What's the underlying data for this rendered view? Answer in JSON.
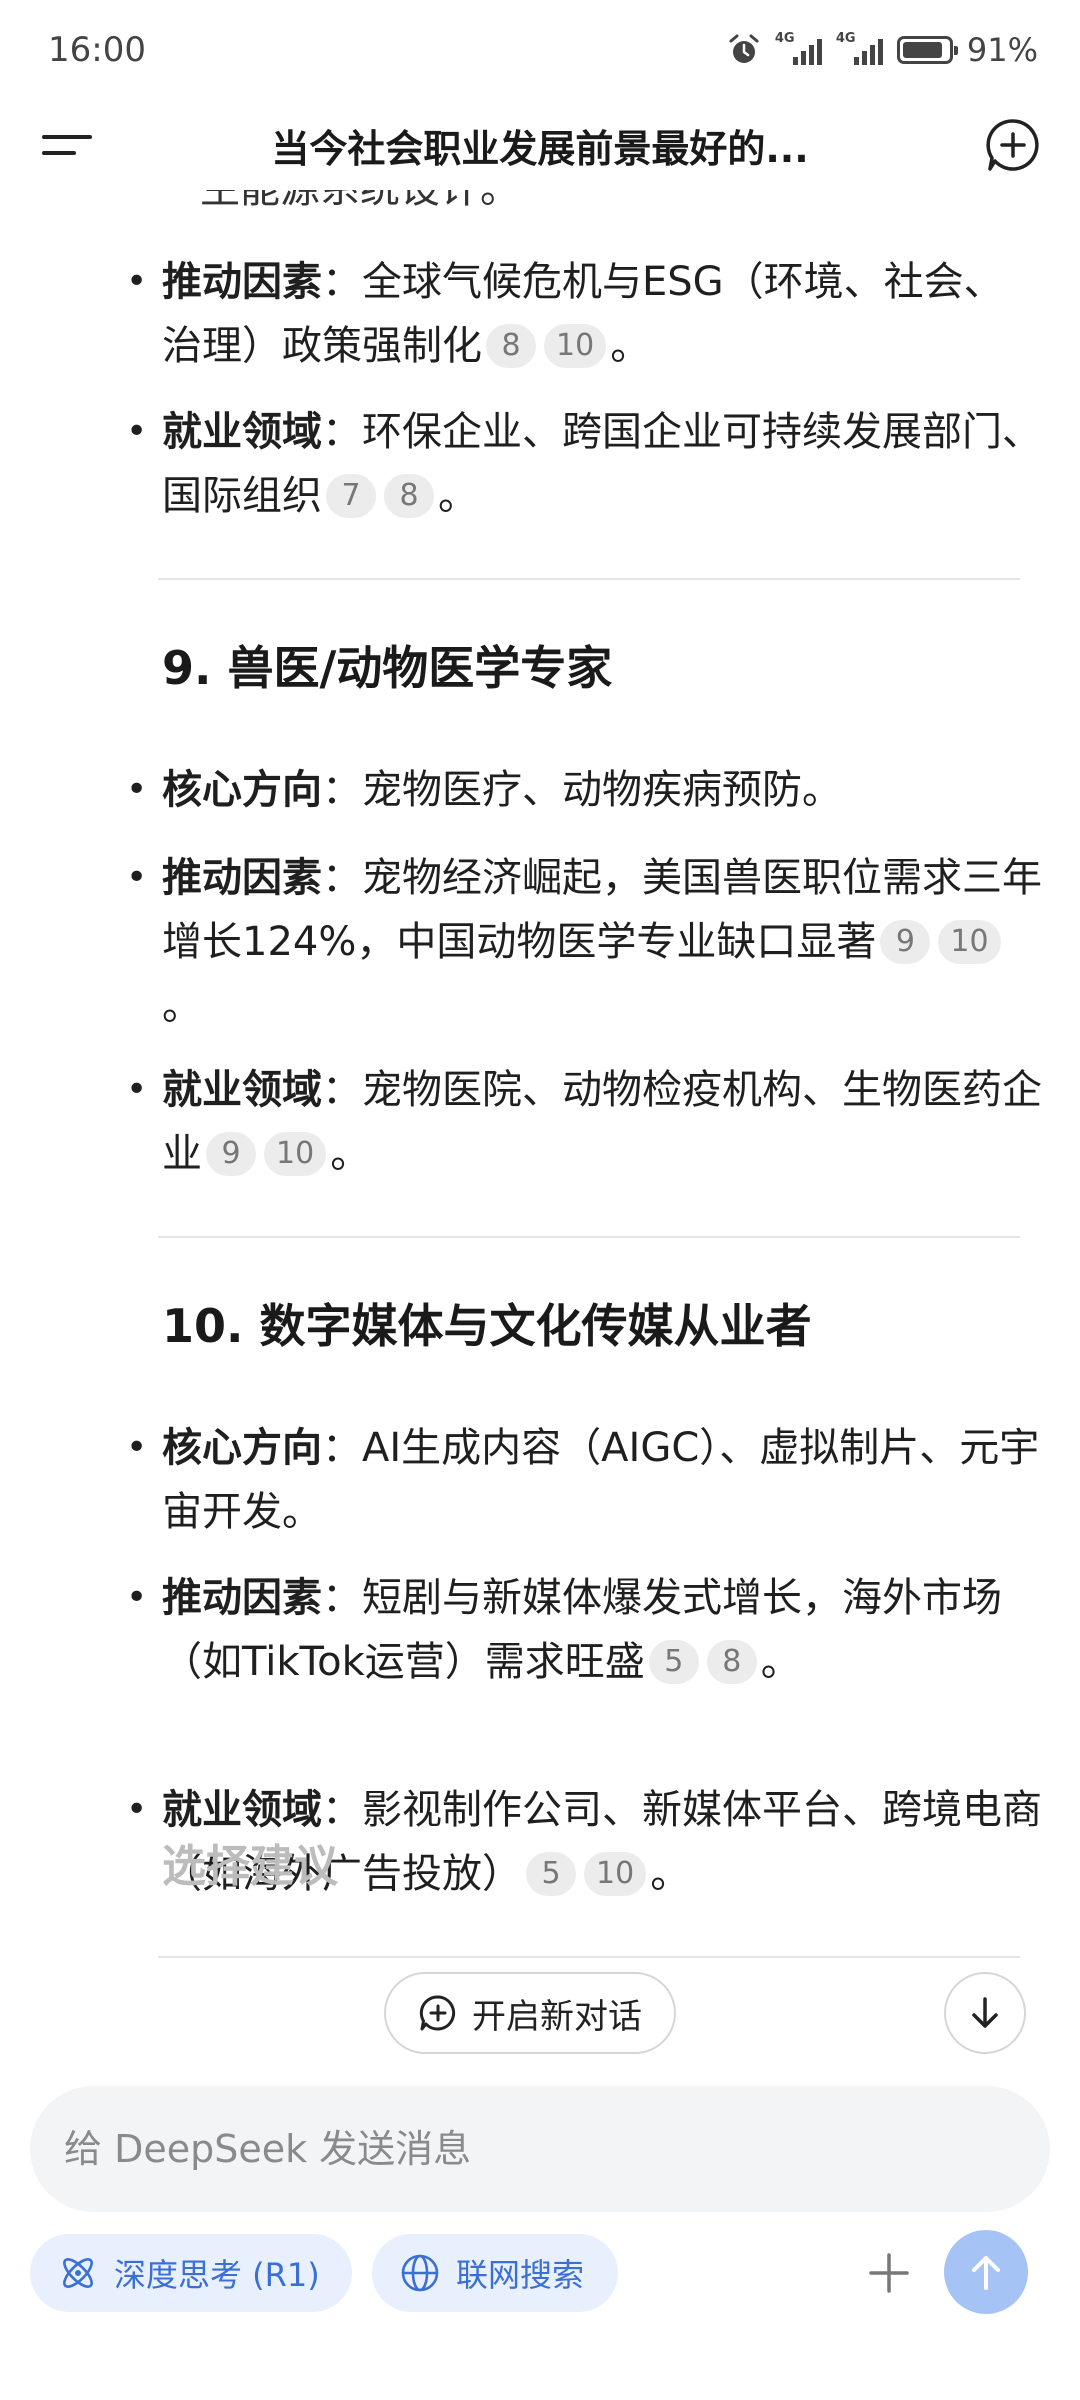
{
  "status_bar": {
    "time": "16:00",
    "network1": "4G",
    "network2": "4G",
    "battery": "91%"
  },
  "header": {
    "title": "当今社会职业发展前景最好的..."
  },
  "content": {
    "cut_text": "生能源系统设计。",
    "prev_items": [
      {
        "label": "推动因素",
        "text": "：全球气候危机与ESG（环境、社会、治理）政策强制化",
        "cites": [
          "8",
          "10"
        ]
      },
      {
        "label": "就业领域",
        "text": "：环保企业、跨国企业可持续发展部门、国际组织",
        "cites": [
          "7",
          "8"
        ]
      }
    ],
    "section9": {
      "title": "9. 兽医/动物医学专家",
      "items": [
        {
          "label": "核心方向",
          "text": "：宠物医疗、动物疾病预防。",
          "cites": []
        },
        {
          "label": "推动因素",
          "text": "：宠物经济崛起，美国兽医职位需求三年增长124%，中国动物医学专业缺口显著",
          "cites": [
            "9",
            "10"
          ]
        },
        {
          "label": "就业领域",
          "text": "：宠物医院、动物检疫机构、生物医药企业",
          "cites": [
            "9",
            "10"
          ]
        }
      ]
    },
    "section10": {
      "title": "10. 数字媒体与文化传媒从业者",
      "items": [
        {
          "label": "核心方向",
          "text": "：AI生成内容（AIGC）、虚拟制片、元宇宙开发。",
          "cites": []
        },
        {
          "label": "推动因素",
          "text": "：短剧与新媒体爆发式增长，海外市场（如TikTok运营）需求旺盛",
          "cites": [
            "5",
            "8"
          ]
        },
        {
          "label": "就业领域",
          "text": "：影视制作公司、新媒体平台、跨境电商（如海外广告投放）",
          "cites": [
            "5",
            "10"
          ]
        }
      ]
    },
    "next_title": "选择建议"
  },
  "floating": {
    "new_chat_label": "开启新对话"
  },
  "composer": {
    "placeholder": "给 DeepSeek 发送消息",
    "deep_think_label": "深度思考 (R1)",
    "web_search_label": "联网搜索"
  }
}
